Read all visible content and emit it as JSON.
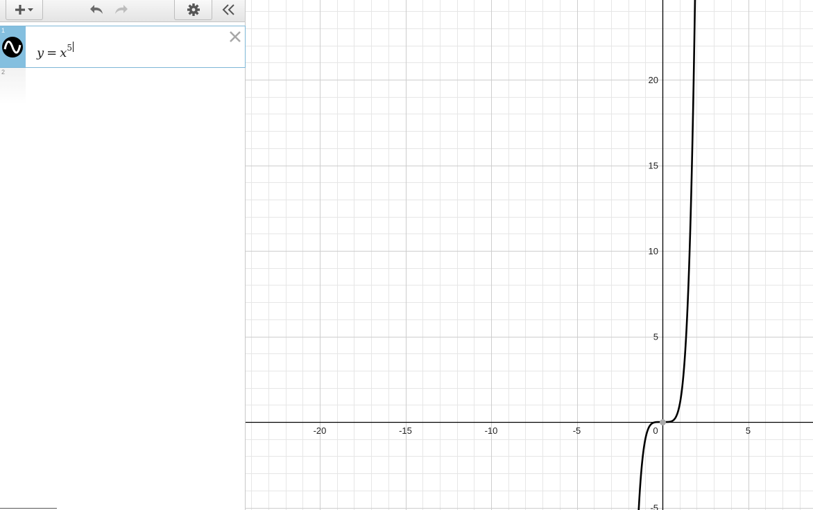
{
  "toolbar": {
    "add_icon": "plus-dropdown-icon",
    "undo_icon": "undo-icon",
    "redo_icon": "redo-icon",
    "settings_icon": "gear-icon",
    "collapse_icon": "double-chevron-left-icon"
  },
  "expressions": [
    {
      "index": "1",
      "lhs": "y",
      "op": "=",
      "base": "x",
      "exponent": "5",
      "color": "#000000",
      "active": true
    },
    {
      "index": "2",
      "empty": true
    }
  ],
  "colors": {
    "accent_tab": "#84bfdf",
    "curve": "#000000",
    "grid_minor": "#e6e6e6",
    "grid_major": "#cdcdcd",
    "axis": "#000000"
  },
  "graph": {
    "x_ticks": [
      "-20",
      "-15",
      "-10",
      "-5",
      "0",
      "5"
    ],
    "y_ticks": [
      "20",
      "15",
      "10",
      "5",
      "-5"
    ],
    "x_range": [
      -24.2,
      8.8
    ],
    "y_range": [
      -5.1,
      24.6
    ],
    "grid": true,
    "function": "x^5"
  }
}
